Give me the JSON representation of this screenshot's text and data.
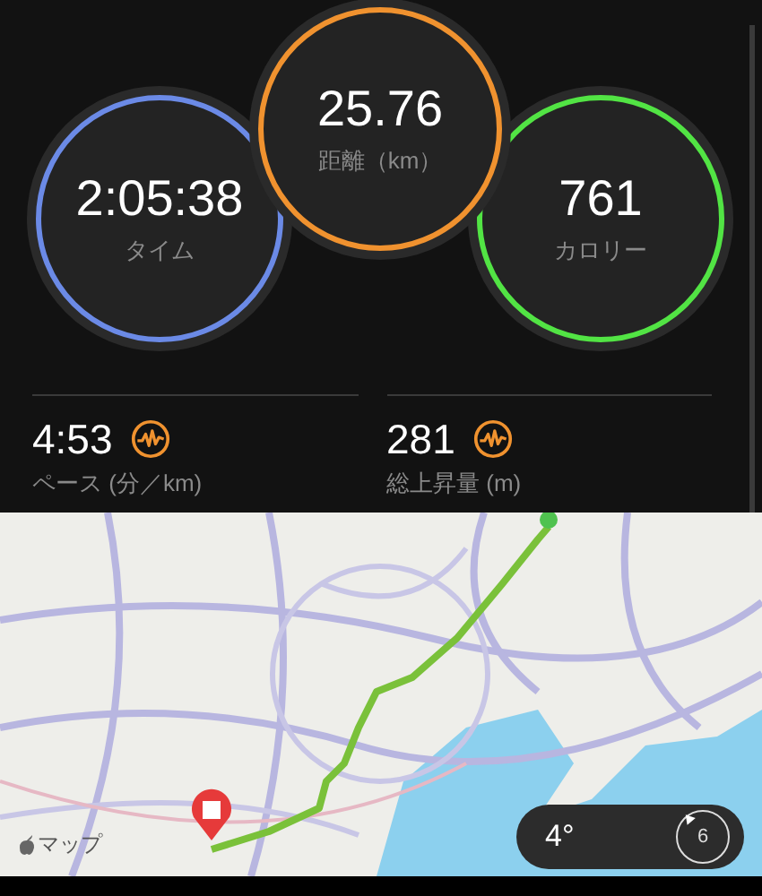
{
  "rings": [
    {
      "value": "2:05:38",
      "label": "タイム",
      "color": "#6b8ae6"
    },
    {
      "value": "25.76",
      "label": "距離（km）",
      "color": "#f0922f"
    },
    {
      "value": "761",
      "label": "カロリー",
      "color": "#52e444"
    }
  ],
  "stats": [
    {
      "value": "4:53",
      "label": "ペース (分／km)"
    },
    {
      "value": "281",
      "label": "総上昇量 (m)"
    }
  ],
  "map": {
    "attribution": "マップ",
    "weather": {
      "temperature": "4°",
      "index": "6"
    }
  }
}
